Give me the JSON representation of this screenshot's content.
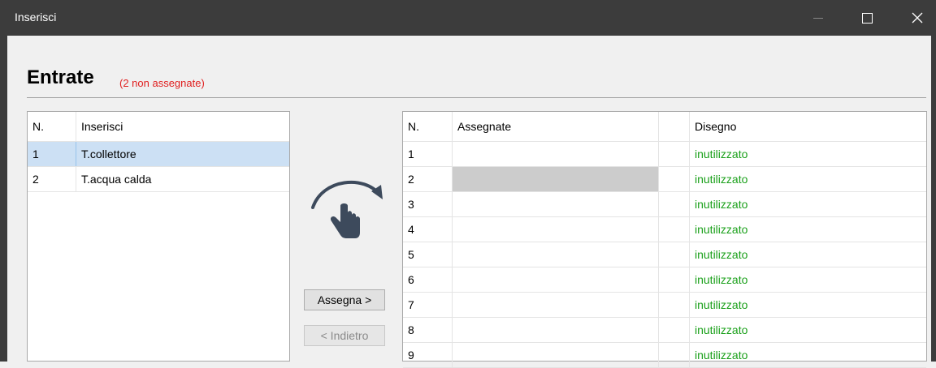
{
  "window": {
    "title": "Inserisci"
  },
  "heading": {
    "title": "Entrate",
    "note": "(2 non assegnate)"
  },
  "left_table": {
    "columns": [
      "N.",
      "Inserisci"
    ],
    "rows": [
      {
        "n": "1",
        "name": "T.collettore"
      },
      {
        "n": "2",
        "name": "T.acqua calda"
      }
    ]
  },
  "buttons": {
    "assign": "Assegna >",
    "back": "< Indietro"
  },
  "right_table": {
    "columns": [
      "N.",
      "Assegnate",
      "Disegno"
    ],
    "rows": [
      {
        "n": "1",
        "assigned": "",
        "drawing": "inutilizzato"
      },
      {
        "n": "2",
        "assigned": "",
        "drawing": "inutilizzato"
      },
      {
        "n": "3",
        "assigned": "",
        "drawing": "inutilizzato"
      },
      {
        "n": "4",
        "assigned": "",
        "drawing": "inutilizzato"
      },
      {
        "n": "5",
        "assigned": "",
        "drawing": "inutilizzato"
      },
      {
        "n": "6",
        "assigned": "",
        "drawing": "inutilizzato"
      },
      {
        "n": "7",
        "assigned": "",
        "drawing": "inutilizzato"
      },
      {
        "n": "8",
        "assigned": "",
        "drawing": "inutilizzato"
      },
      {
        "n": "9",
        "assigned": "",
        "drawing": "inutilizzato"
      }
    ]
  },
  "colors": {
    "note": "#e02020",
    "unused": "#1aa01a",
    "selection": "#cce0f4"
  },
  "icons": {
    "drag": "curved-arrow-hand-icon"
  }
}
